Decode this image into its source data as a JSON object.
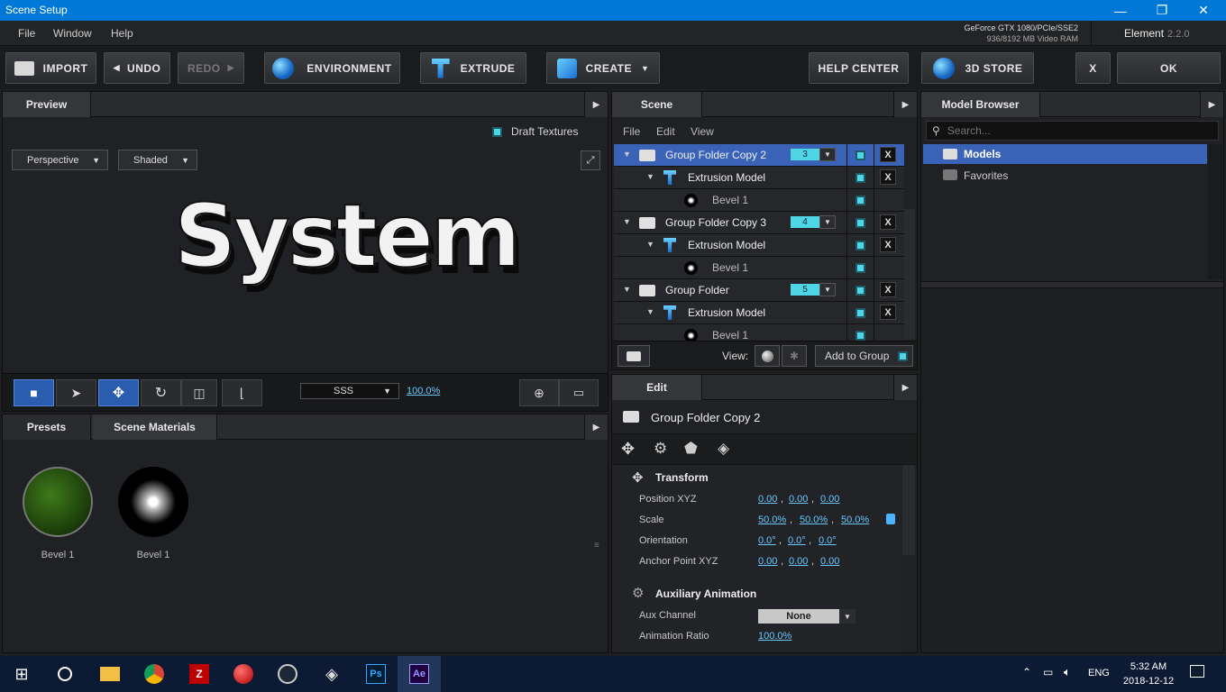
{
  "window": {
    "title": "Scene Setup",
    "minimize": "—",
    "maximize": "❐",
    "close": "✕"
  },
  "menu": {
    "items": [
      "File",
      "Window",
      "Help"
    ]
  },
  "gpu": {
    "name": "GeForce GTX 1080/PCIe/SSE2",
    "vram": "936/8192 MB Video RAM"
  },
  "app": {
    "name": "Element",
    "version": "2.2.0"
  },
  "toolbar": {
    "import": "IMPORT",
    "undo": "UNDO",
    "redo": "REDO",
    "environment": "ENVIRONMENT",
    "extrude": "EXTRUDE",
    "create": "CREATE",
    "help_center": "HELP CENTER",
    "store": "3D STORE",
    "x": "X",
    "ok": "OK"
  },
  "preview": {
    "tab": "Preview",
    "draft_textures": "Draft Textures",
    "view_mode": "Perspective",
    "shading": "Shaded",
    "text3d": "System",
    "render_mode": "SSS",
    "zoom": "100.0%"
  },
  "presets": {
    "tabs": [
      "Presets",
      "Scene Materials"
    ],
    "items": [
      {
        "label": "Bevel 1"
      },
      {
        "label": "Bevel 1"
      }
    ]
  },
  "scene": {
    "tab": "Scene",
    "menu": [
      "File",
      "Edit",
      "View"
    ],
    "rows": [
      {
        "label": "Group Folder Copy 2",
        "num": "3"
      },
      {
        "label": "Extrusion Model"
      },
      {
        "label": "Bevel 1"
      },
      {
        "label": "Group Folder Copy 3",
        "num": "4"
      },
      {
        "label": "Extrusion Model"
      },
      {
        "label": "Bevel 1"
      },
      {
        "label": "Group Folder",
        "num": "5"
      },
      {
        "label": "Extrusion Model"
      },
      {
        "label": "Bevel 1"
      }
    ],
    "x": "X",
    "view_label": "View:",
    "add_to_group": "Add to Group"
  },
  "edit": {
    "tab": "Edit",
    "title": "Group Folder Copy 2",
    "transform": {
      "heading": "Transform",
      "position_label": "Position XYZ",
      "position": [
        "0.00",
        "0.00",
        "0.00"
      ],
      "scale_label": "Scale",
      "scale": [
        "50.0%",
        "50.0%",
        "50.0%"
      ],
      "orientation_label": "Orientation",
      "orientation": [
        "0.0°",
        "0.0°",
        "0.0°"
      ],
      "anchor_label": "Anchor Point XYZ",
      "anchor": [
        "0.00",
        "0.00",
        "0.00"
      ]
    },
    "aux": {
      "heading": "Auxiliary Animation",
      "channel_label": "Aux Channel",
      "channel": "None",
      "ratio_label": "Animation Ratio",
      "ratio": "100.0%"
    },
    "sep": ","
  },
  "model_browser": {
    "tab": "Model Browser",
    "search_placeholder": "Search...",
    "items": [
      {
        "label": "Models"
      },
      {
        "label": "Favorites"
      }
    ]
  },
  "taskbar": {
    "lang": "ENG",
    "time": "5:32 AM",
    "date": "2018-12-12",
    "ps": "Ps",
    "ae": "Ae"
  }
}
